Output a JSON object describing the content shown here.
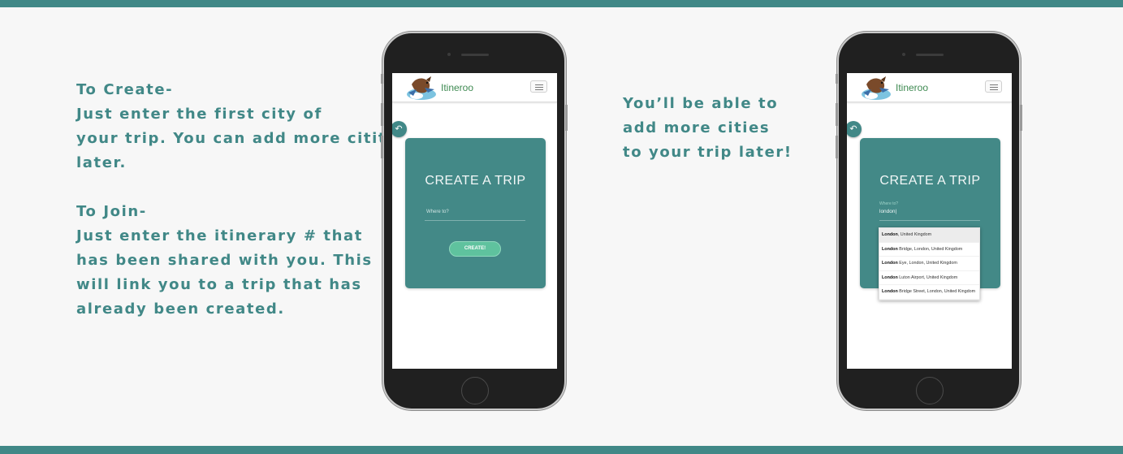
{
  "left_copy": {
    "create_heading": "To Create-",
    "create_lines": [
      "Just enter the first city of",
      "your trip. You can add more citites",
      "later."
    ],
    "join_heading": "To Join-",
    "join_lines": [
      "Just enter the itinerary # that",
      "has been shared with you. This",
      "will link you to a trip that has",
      "already been created."
    ]
  },
  "middle_copy": {
    "lines": [
      "You’ll be able to",
      "add more cities",
      "to your trip later!"
    ]
  },
  "app": {
    "brand": "Itineroo",
    "card_title": "CREATE A TRIP",
    "input_placeholder": "Where to?",
    "create_button": "CREATE!"
  },
  "phone_two": {
    "input_label": "Where to?",
    "input_value": "london|",
    "suggestions": [
      {
        "match": "London",
        "rest": ", United Kingdom"
      },
      {
        "match": "London",
        "rest": " Bridge, London, United Kingdom"
      },
      {
        "match": "London",
        "rest": " Eye, London, United Kingdom"
      },
      {
        "match": "London",
        "rest": " Luton Airport, United Kingdom"
      },
      {
        "match": "London",
        "rest": " Bridge Street, London, United Kingdom"
      }
    ]
  },
  "colors": {
    "accent": "#418887",
    "card": "#438987",
    "button": "#5fc29e",
    "brand_text": "#3f8a52"
  },
  "icons": [
    "back-arrow-icon",
    "hamburger-menu-icon",
    "kangaroo-logo-icon"
  ]
}
